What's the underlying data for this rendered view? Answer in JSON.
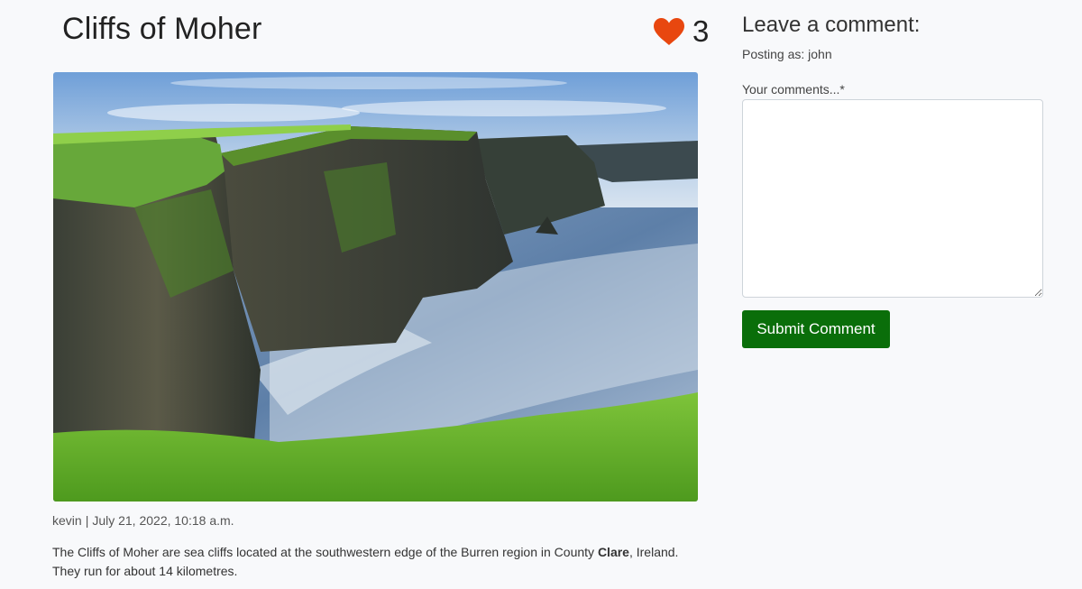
{
  "post": {
    "title": "Cliffs of Moher",
    "likes": "3",
    "author": "kevin",
    "date": "July 21, 2022, 10:18 a.m.",
    "meta_separator": "|",
    "body_before": "The Cliffs of Moher are sea cliffs located at the southwestern edge of the Burren region in County ",
    "body_bold": "Clare",
    "body_after": ", Ireland. They run for about 14 kilometres.",
    "image_icon": "landscape-photo",
    "like_icon": "heart-icon",
    "like_color": "#e8470f"
  },
  "comment_form": {
    "heading": "Leave a comment:",
    "posting_as": "Posting as: john",
    "field_label": "Your comments...*",
    "field_value": "",
    "submit_label": "Submit Comment",
    "submit_color": "#0a6e0a"
  }
}
